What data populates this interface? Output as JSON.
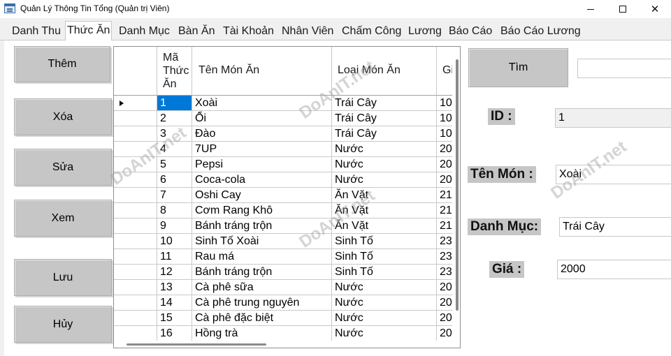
{
  "window": {
    "title": "Quản Lý Thông Tin Tổng (Quản trị Viên)"
  },
  "tabs": [
    {
      "label": "Danh Thu"
    },
    {
      "label": "Thức Ăn"
    },
    {
      "label": "Danh Mục"
    },
    {
      "label": "Bàn Ăn"
    },
    {
      "label": "Tài Khoản"
    },
    {
      "label": "Nhân Viên"
    },
    {
      "label": "Chấm Công"
    },
    {
      "label": "Lương"
    },
    {
      "label": "Báo Cáo"
    },
    {
      "label": "Báo Cáo Lương"
    }
  ],
  "actions": {
    "add": "Thêm",
    "delete": "Xóa",
    "edit": "Sửa",
    "view": "Xem",
    "save": "Lưu",
    "cancel": "Hủy"
  },
  "grid": {
    "columns": {
      "id": "Mã Thức Ăn",
      "name": "Tên Món Ăn",
      "category": "Loại Món Ăn",
      "price": "Gi"
    },
    "rows": [
      {
        "id": "1",
        "name": "Xoài",
        "category": "Trái Cây",
        "price": "10"
      },
      {
        "id": "2",
        "name": "Ổi",
        "category": "Trái Cây",
        "price": "10"
      },
      {
        "id": "3",
        "name": "Đào",
        "category": "Trái Cây",
        "price": "10"
      },
      {
        "id": "4",
        "name": "7UP",
        "category": "Nước",
        "price": "20"
      },
      {
        "id": "5",
        "name": "Pepsi",
        "category": "Nước",
        "price": "20"
      },
      {
        "id": "6",
        "name": "Coca-cola",
        "category": "Nước",
        "price": "20"
      },
      {
        "id": "7",
        "name": "Oshi Cay",
        "category": "Ăn Vặt",
        "price": "21"
      },
      {
        "id": "8",
        "name": "Cơm Rang Khô",
        "category": "Ăn Vặt",
        "price": "21"
      },
      {
        "id": "9",
        "name": "Bánh tráng trộn",
        "category": "Ăn Vặt",
        "price": "21"
      },
      {
        "id": "10",
        "name": "Sinh Tố Xoài",
        "category": "Sinh Tố",
        "price": "23"
      },
      {
        "id": "11",
        "name": "Rau má",
        "category": "Sinh Tố",
        "price": "23"
      },
      {
        "id": "12",
        "name": "Bánh tráng trộn",
        "category": "Sinh Tố",
        "price": "23"
      },
      {
        "id": "13",
        "name": "Cà phê sữa",
        "category": "Nước",
        "price": "20"
      },
      {
        "id": "14",
        "name": "Cà phê trung nguyên",
        "category": "Nước",
        "price": "20"
      },
      {
        "id": "15",
        "name": "Cà phê đặc biệt",
        "category": "Nước",
        "price": "20"
      },
      {
        "id": "16",
        "name": "Hồng trà",
        "category": "Nước",
        "price": "20"
      }
    ]
  },
  "form": {
    "search_label": "Tìm",
    "search_value": "",
    "id_label": "ID :",
    "id_value": "1",
    "name_label": "Tên Món :",
    "name_value": "Xoài",
    "category_label": "Danh Mục:",
    "category_value": "Trái Cây",
    "price_label": "Giá :",
    "price_value": "2000"
  },
  "watermark": "DoAnIT.net"
}
